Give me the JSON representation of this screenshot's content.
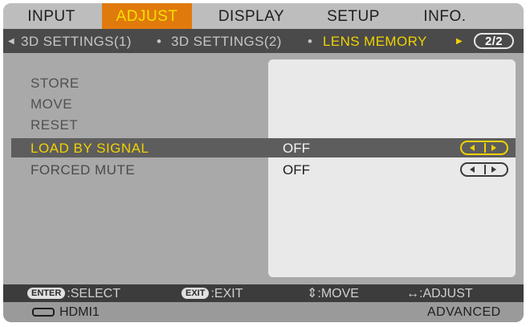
{
  "tabs": [
    {
      "label": "INPUT",
      "active": false
    },
    {
      "label": "ADJUST",
      "active": true
    },
    {
      "label": "DISPLAY",
      "active": false
    },
    {
      "label": "SETUP",
      "active": false
    },
    {
      "label": "INFO.",
      "active": false
    }
  ],
  "subtabs": {
    "left_arrow": "◀",
    "items": [
      "3D SETTINGS(1)",
      "3D SETTINGS(2)",
      "LENS MEMORY"
    ],
    "separator": "•",
    "right_arrow": "▶",
    "page": "2/2"
  },
  "actions": [
    "STORE",
    "MOVE",
    "RESET"
  ],
  "settings": [
    {
      "label": "LOAD BY SIGNAL",
      "value": "OFF",
      "selected": true
    },
    {
      "label": "FORCED MUTE",
      "value": "OFF",
      "selected": false
    }
  ],
  "help": {
    "enter_key": "ENTER",
    "enter_text": ":SELECT",
    "exit_key": "EXIT",
    "exit_text": ":EXIT",
    "move_sym": "⇕",
    "move_text": ":MOVE",
    "adjust_sym": "↔",
    "adjust_text": ":ADJUST"
  },
  "status": {
    "source_icon": "hdmi-connector-icon",
    "source": "HDMI1",
    "mode": "ADVANCED"
  },
  "colors": {
    "active_tab": "#e07a0c",
    "highlight_text": "#f0d200",
    "selected_row": "#5d5d5d"
  }
}
